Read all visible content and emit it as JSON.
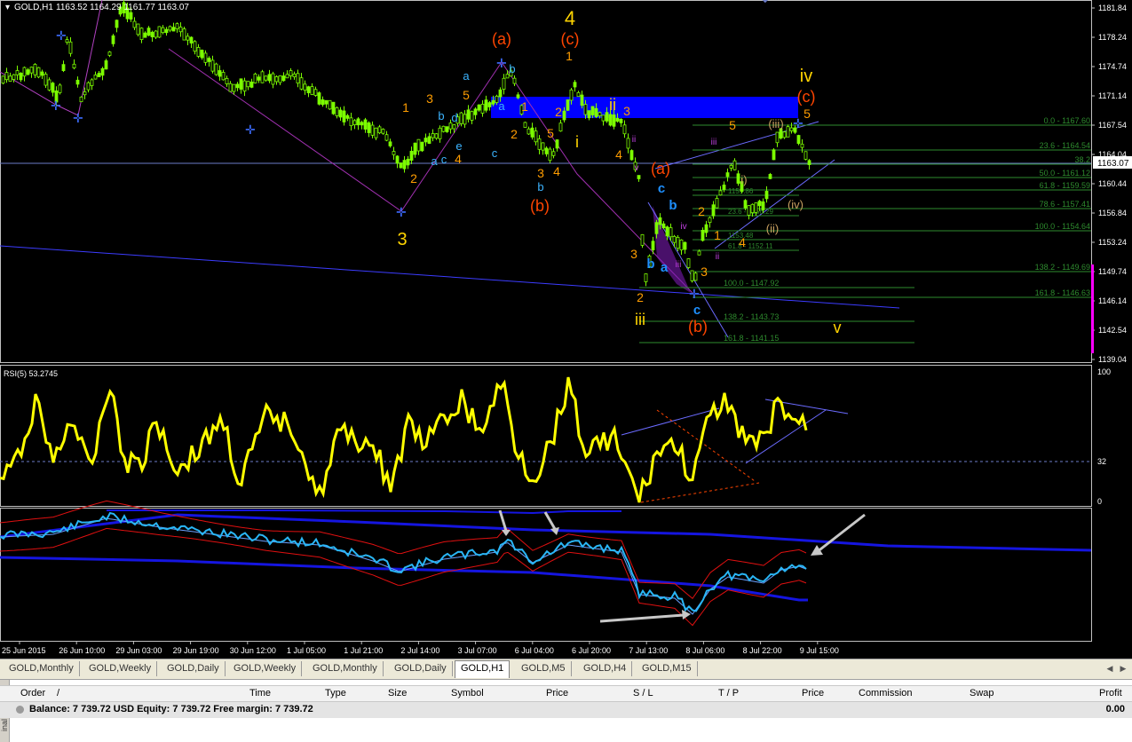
{
  "chart": {
    "title": "GOLD,H1",
    "ohlc": "1163.52 1164.29 1161.77 1163.07",
    "current_price": "1163.07",
    "price_ticks": [
      "1181.84",
      "1178.24",
      "1174.74",
      "1171.14",
      "1167.54",
      "1164.04",
      "1160.44",
      "1156.84",
      "1153.24",
      "1149.74",
      "1146.14",
      "1142.54",
      "1139.04"
    ],
    "time_ticks": [
      "25 Jun 2015",
      "26 Jun 10:00",
      "29 Jun 03:00",
      "29 Jun 19:00",
      "30 Jun 12:00",
      "1 Jul 05:00",
      "1 Jul 21:00",
      "2 Jul 14:00",
      "3 Jul 07:00",
      "6 Jul 04:00",
      "6 Jul 20:00",
      "7 Jul 13:00",
      "8 Jul 06:00",
      "8 Jul 22:00",
      "9 Jul 15:00"
    ],
    "fibo_levels": [
      "0.0 - 1167.60",
      "23.6 - 1164.54",
      "38.2",
      "50.0 - 1161.12",
      "61.8 - 1159.59",
      "78.6 - 1157.41",
      "100.0 - 1154.64",
      "138.2 - 1149.69",
      "161.8 - 1146.63"
    ],
    "fibo2_levels": [
      "100.0 - 1147.92",
      "138.2 - 1143.73",
      "161.8 - 1141.15"
    ],
    "fibo3_levels": [
      "1159.86",
      "23.6 - 1156.29",
      "1153.48",
      "61.8 - 1152.11"
    ],
    "wave_labels_yellow": [
      "4",
      "3",
      "iv",
      "iii",
      "v",
      "ii",
      "i"
    ],
    "wave_labels_red": [
      "(a)",
      "(c)",
      "(b)",
      "(a)",
      "(c)",
      "(b)"
    ],
    "wave_labels_orange": [
      "1",
      "2",
      "3",
      "4",
      "5",
      "1",
      "2",
      "3",
      "4",
      "5",
      "2",
      "1",
      "3",
      "4",
      "5",
      "3",
      "2",
      "3",
      "2",
      "1",
      "4",
      "5"
    ],
    "wave_labels_blue": [
      "a",
      "b",
      "c",
      "d",
      "e",
      "a",
      "b",
      "c",
      "a",
      "b",
      "b",
      "c",
      "a",
      "b",
      "c"
    ],
    "wave_labels_purple": [
      "ii",
      "iii",
      "v",
      "iv",
      "iii",
      "ii"
    ],
    "wave_labels_tan": [
      "(iii)",
      "(iv)",
      "(ii)",
      "i)"
    ],
    "colors": {
      "candle": "#7cfc00",
      "channel": "#0000ff",
      "rsi": "#ffff00",
      "fibo": "#2e8b2e",
      "red_label": "#ff4500",
      "orange_label": "#ff9d00"
    }
  },
  "rsi": {
    "title": "RSI(5) 53.2745",
    "ticks": [
      "100",
      "32",
      "0"
    ]
  },
  "tabs": [
    "GOLD,Monthly",
    "GOLD,Weekly",
    "GOLD,Daily",
    "GOLD,Weekly",
    "GOLD,Monthly",
    "GOLD,Daily",
    "GOLD,H1",
    "GOLD,M5",
    "GOLD,H4",
    "GOLD,M15"
  ],
  "active_tab": "GOLD,H1",
  "terminal": {
    "columns": [
      "Order",
      "/",
      "Time",
      "Type",
      "Size",
      "Symbol",
      "Price",
      "S / L",
      "T / P",
      "Price",
      "Commission",
      "Swap",
      "Profit"
    ],
    "balance": "Balance: 7 739.72 USD  Equity: 7 739.72  Free margin: 7 739.72",
    "total": "0.00",
    "side_label": "inal"
  }
}
